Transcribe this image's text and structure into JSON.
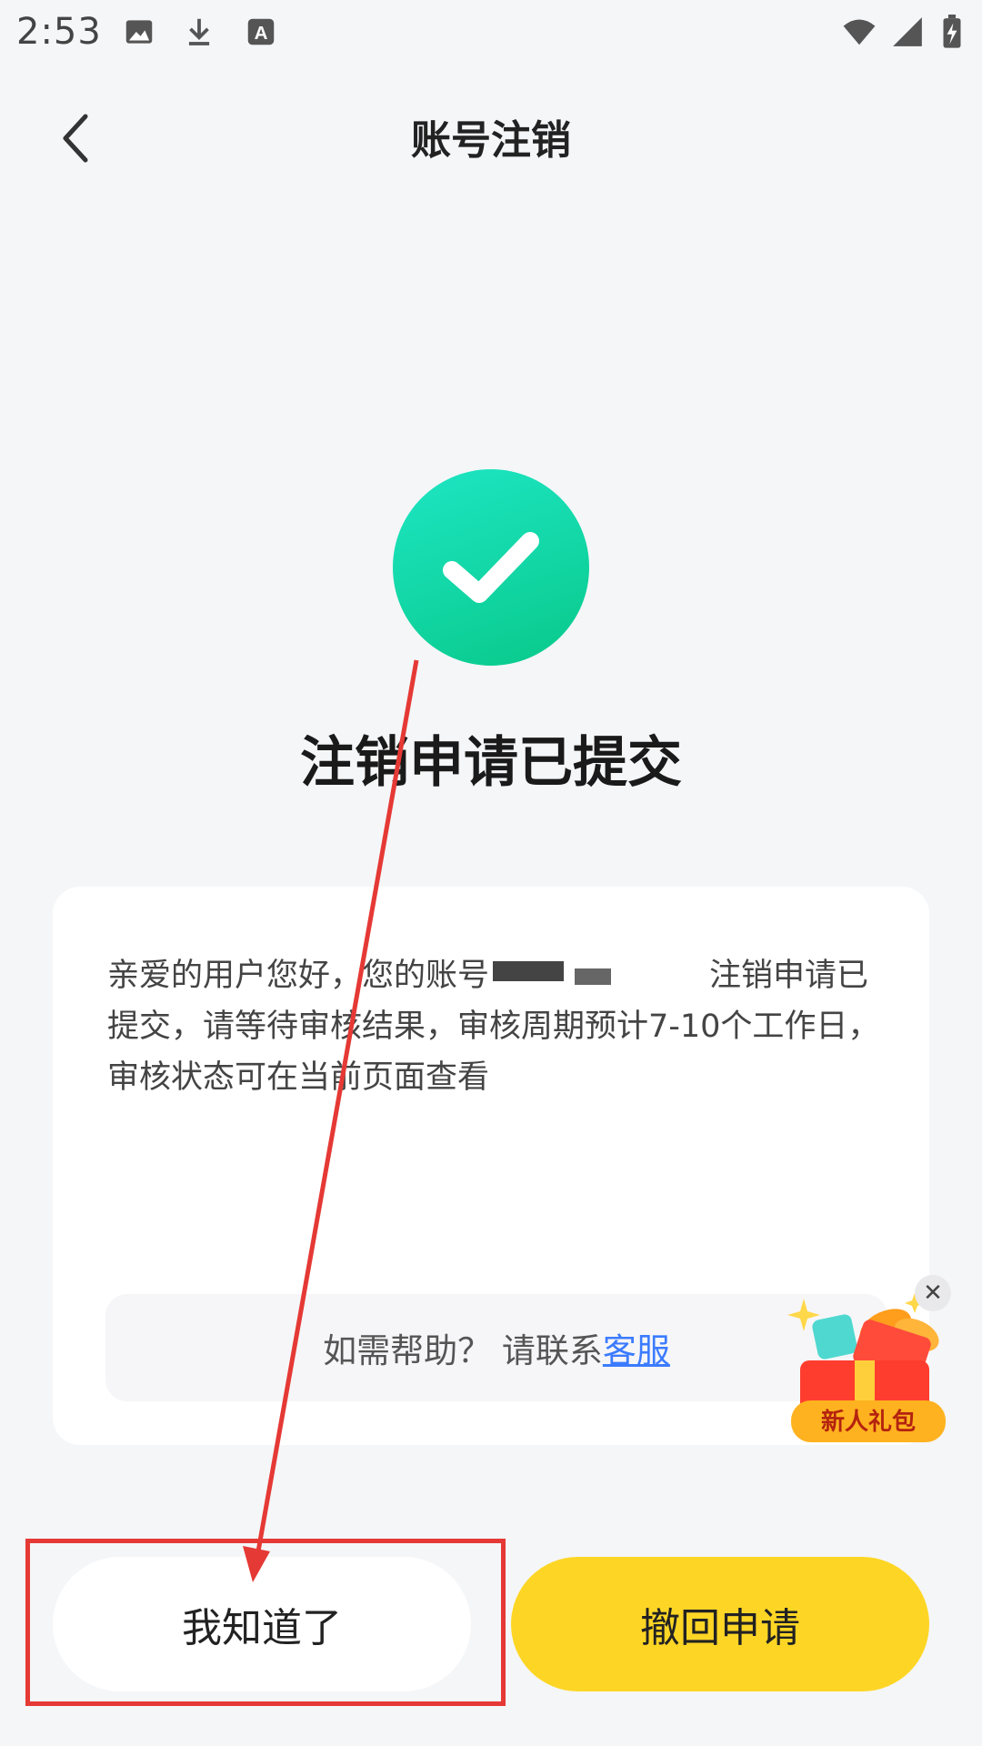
{
  "status_bar": {
    "time": "2:53",
    "icons": [
      "image-icon",
      "download-icon",
      "text-icon",
      "wifi-icon",
      "signal-icon",
      "battery-charging-icon"
    ]
  },
  "header": {
    "back_icon": "chevron-left-icon",
    "title": "账号注销"
  },
  "success": {
    "icon": "checkmark-icon",
    "headline": "注销申请已提交"
  },
  "card": {
    "message_start": "亲爱的用户您好，您的账号",
    "message_end": "注销申请已提交，请等待审核结果，审核周期预计7-10个工作日，审核状态可在当前页面查看",
    "help_prefix": "如需帮助？ 请联系",
    "help_link": "客服"
  },
  "gift": {
    "label": "新人礼包",
    "close_icon": "close-icon"
  },
  "buttons": {
    "acknowledge": "我知道了",
    "withdraw": "撤回申请"
  },
  "colors": {
    "accent_yellow": "#fdd625",
    "success_green": "#08c98a",
    "link_blue": "#3b7bff",
    "annotation_red": "#e53935"
  }
}
